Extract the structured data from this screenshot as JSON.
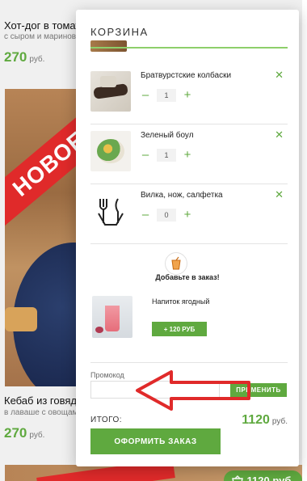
{
  "catalog": {
    "card1": {
      "title": "Хот-дог в томате",
      "subtitle": "с сыром и маринованным",
      "price": "270",
      "currency": "руб."
    },
    "card2": {
      "ribbon": "НОВОЕ",
      "title": "Кебаб из говядины",
      "subtitle": "в лаваше с овощами",
      "price": "270",
      "currency": "руб."
    },
    "mini_cart": {
      "icon": "basket-icon",
      "total": "1120 руб."
    }
  },
  "cart": {
    "title": "КОРЗИНА",
    "items": [
      {
        "name": "Братвурстские колбаски",
        "qty": "1"
      },
      {
        "name": "Зеленый боул",
        "qty": "1"
      },
      {
        "name": "Вилка, нож, салфетка",
        "qty": "0"
      }
    ],
    "controls": {
      "minus": "–",
      "plus": "+",
      "remove": "✕"
    },
    "upsell": {
      "title": "Добавьте в заказ!",
      "item_name": "Напиток ягодный",
      "add_label": "+ 120 РУБ"
    },
    "promo": {
      "label": "Промокод",
      "value": "",
      "apply_label": "ПРИМЕНИТЬ"
    },
    "total": {
      "label": "ИТОГО:",
      "value": "1120",
      "currency": "руб."
    },
    "checkout_label": "ОФОРМИТЬ ЗАКАЗ"
  },
  "colors": {
    "accent": "#5fa93f",
    "annotation_arrow": "#e02a2a"
  }
}
